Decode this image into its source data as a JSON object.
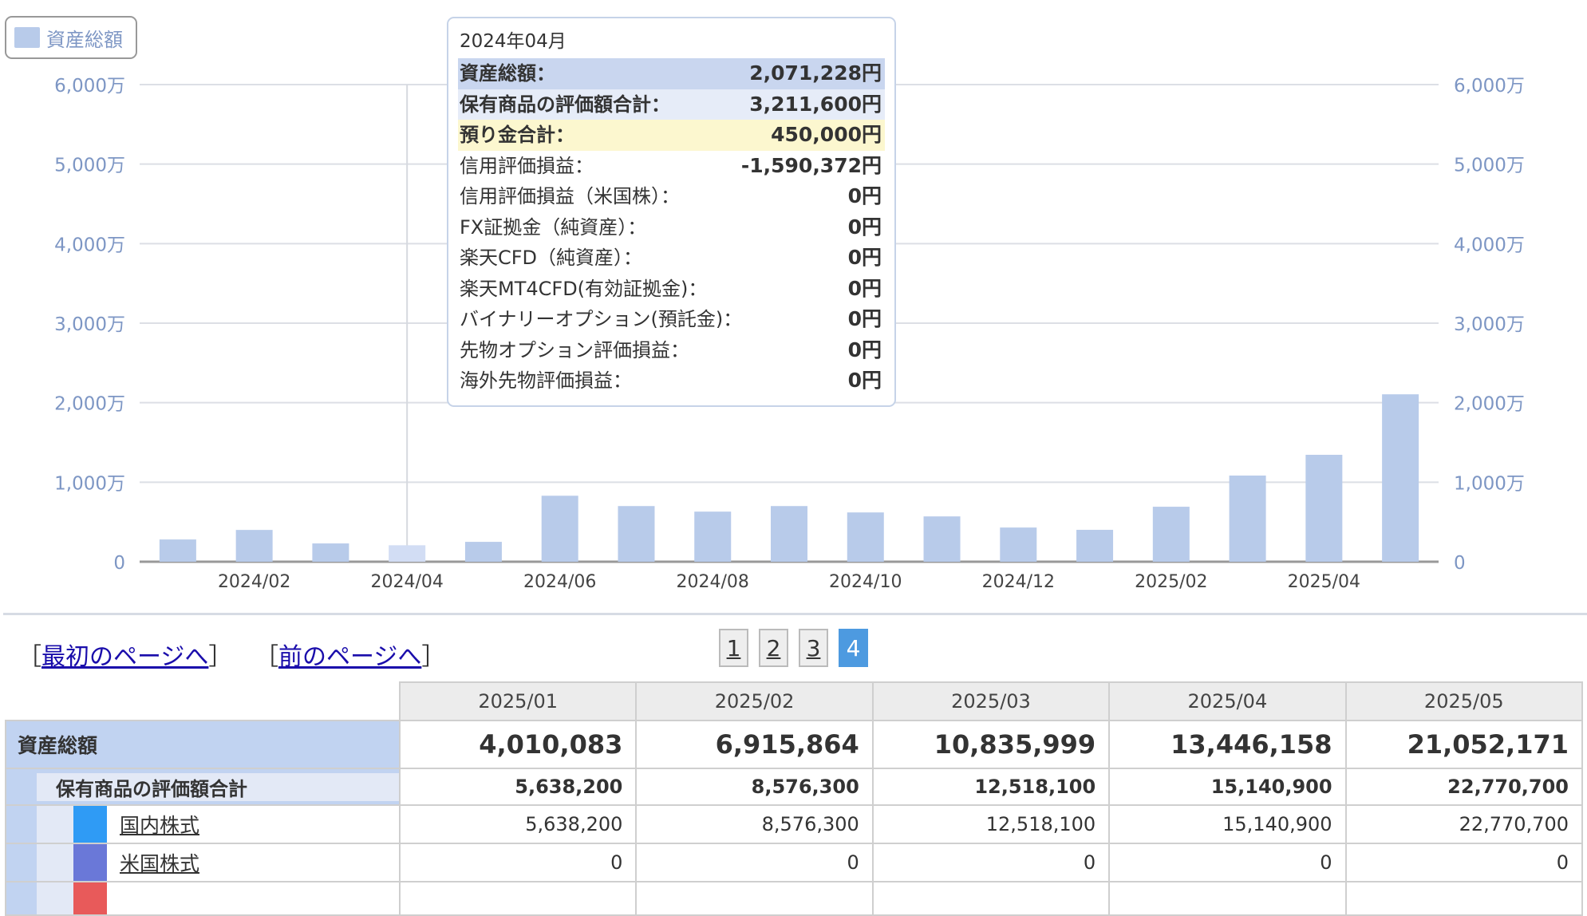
{
  "legend": {
    "label": "資産総額",
    "color": "#b8cbea"
  },
  "chart_data": {
    "type": "bar",
    "categories": [
      "2024/01",
      "2024/02",
      "2024/03",
      "2024/04",
      "2024/05",
      "2024/06",
      "2024/07",
      "2024/08",
      "2024/09",
      "2024/10",
      "2024/11",
      "2024/12",
      "2025/01",
      "2025/02",
      "2025/03",
      "2025/04",
      "2025/05"
    ],
    "values": [
      2800000,
      4000000,
      2300000,
      2071228,
      2500000,
      8300000,
      7000000,
      6300000,
      7000000,
      6200000,
      5700000,
      4300000,
      4010083,
      6915864,
      10835999,
      13446158,
      21052171
    ],
    "series": [
      {
        "name": "資産総額",
        "color": "#b8cbea"
      }
    ],
    "xtick_labels": [
      "2024/02",
      "2024/04",
      "2024/06",
      "2024/08",
      "2024/10",
      "2024/12",
      "2025/02",
      "2025/04"
    ],
    "ytick_labels": [
      "0",
      "1,000万",
      "2,000万",
      "3,000万",
      "4,000万",
      "5,000万",
      "6,000万"
    ],
    "ytick_values": [
      0,
      10000000,
      20000000,
      30000000,
      40000000,
      50000000,
      60000000
    ],
    "ylim": [
      0,
      60000000
    ],
    "highlight_category": "2024/04",
    "highlight_color": "#d2ddf4",
    "grid": true,
    "title": "",
    "xlabel": "",
    "ylabel": ""
  },
  "tooltip": {
    "title": "2024年04月",
    "rows": [
      {
        "label": "資産総額：",
        "value": "2,071,228円"
      },
      {
        "label": "保有商品の評価額合計：",
        "value": "3,211,600円"
      },
      {
        "label": "預り金合計：",
        "value": "450,000円"
      },
      {
        "label": "信用評価損益：",
        "value": "-1,590,372円"
      },
      {
        "label": "信用評価損益（米国株）：",
        "value": "0円"
      },
      {
        "label": "FX証拠金（純資産）：",
        "value": "0円"
      },
      {
        "label": "楽天CFD（純資産）：",
        "value": "0円"
      },
      {
        "label": "楽天MT4CFD(有効証拠金)：",
        "value": "0円"
      },
      {
        "label": "バイナリーオプション(預託金)：",
        "value": "0円"
      },
      {
        "label": "先物オプション評価損益：",
        "value": "0円"
      },
      {
        "label": "海外先物評価損益：",
        "value": "0円"
      }
    ]
  },
  "nav": {
    "first_page": "最初のページへ",
    "prev_page": "前のページへ",
    "open_bracket": "［",
    "close_bracket": "］"
  },
  "pager": {
    "pages": [
      "1",
      "2",
      "3",
      "4"
    ],
    "active": "4"
  },
  "table": {
    "columns": [
      "2025/01",
      "2025/02",
      "2025/03",
      "2025/04",
      "2025/05"
    ],
    "total": {
      "label": "資産総額",
      "values": [
        "4,010,083",
        "6,915,864",
        "10,835,999",
        "13,446,158",
        "21,052,171"
      ]
    },
    "holdings": {
      "label": "保有商品の評価額合計",
      "values": [
        "5,638,200",
        "8,576,300",
        "12,518,100",
        "15,140,900",
        "22,770,700"
      ]
    },
    "domestic": {
      "label": "国内株式",
      "color": "#2f9bf5",
      "values": [
        "5,638,200",
        "8,576,300",
        "12,518,100",
        "15,140,900",
        "22,770,700"
      ]
    },
    "us": {
      "label": "米国株式",
      "color": "#6a78d8",
      "values": [
        "0",
        "0",
        "0",
        "0",
        "0"
      ]
    }
  }
}
